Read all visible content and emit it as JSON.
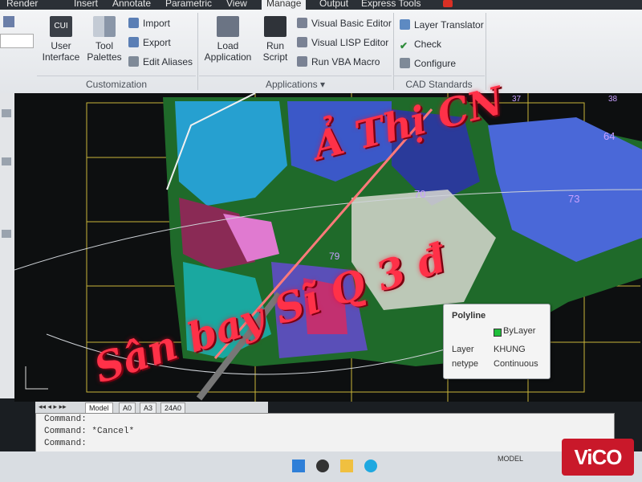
{
  "ribbon": {
    "tabs": [
      "Render",
      "Insert",
      "Annotate",
      "Parametric",
      "View",
      "Manage",
      "Output",
      "Express Tools"
    ],
    "active_tab": "Manage",
    "customization": {
      "title": "Customization",
      "user_interface": "User Interface",
      "tool_palettes": "Tool Palettes",
      "import": "Import",
      "export": "Export",
      "edit_aliases": "Edit Aliases",
      "cui_badge": "CUI"
    },
    "applications": {
      "title": "Applications",
      "load_application": "Load Application",
      "run_script": "Run Script",
      "visual_basic_editor": "Visual Basic Editor",
      "visual_lisp_editor": "Visual LISP Editor",
      "run_vba_macro": "Run VBA Macro"
    },
    "cad_standards": {
      "title": "CAD Standards",
      "layer_translator": "Layer Translator",
      "check": "Check",
      "configure": "Configure"
    }
  },
  "drawing": {
    "grid_labels": [
      "64",
      "70",
      "73",
      "79",
      "37",
      "38"
    ],
    "sheet_tabs": [
      "Model",
      "A0",
      "A3",
      "24A0"
    ]
  },
  "property_tooltip": {
    "title": "Polyline",
    "rows": [
      {
        "key": "",
        "value": "ByLayer"
      },
      {
        "key": "Layer",
        "value": "KHUNG"
      },
      {
        "key": "netype",
        "value": "Continuous"
      }
    ],
    "swatch_color": "#1fbf3a"
  },
  "command_line": {
    "lines": [
      "Command:",
      "Command: *Cancel*",
      "Command:"
    ]
  },
  "status_bar": {
    "mode": "MODEL"
  },
  "handwriting": {
    "line1": "Ả Thị CN",
    "line2": "Sân bay Sĩ Q 3 đ"
  },
  "watermark": "ViCO",
  "colors": {
    "accent_red": "#ff3148",
    "ribbon_bg": "#eef0f2",
    "canvas_bg": "#0d0f10"
  }
}
